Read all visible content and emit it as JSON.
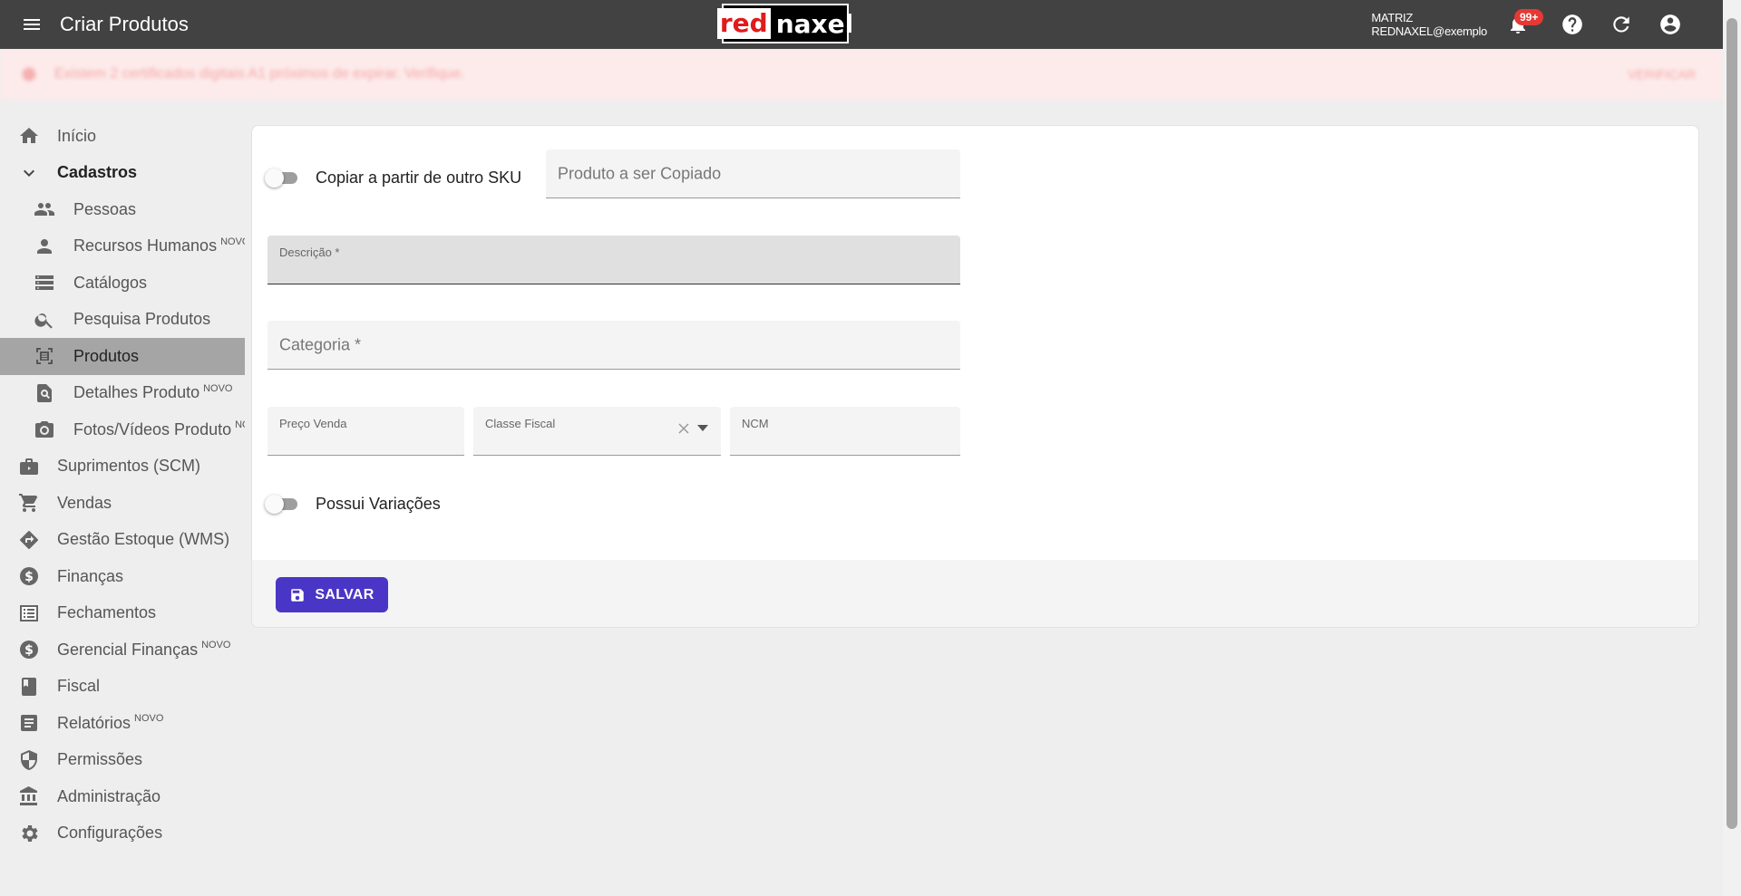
{
  "header": {
    "title": "Criar Produtos",
    "logo_left": "red",
    "logo_right": "naxel",
    "company": "MATRIZ",
    "user": "REDNAXEL@exemplo",
    "notifications_badge": "99+"
  },
  "alert": {
    "text": "Existem 2 certificados digitais A1 próximos de expirar. Verifique.",
    "action": "VERIFICAR"
  },
  "sidebar": {
    "items": [
      {
        "label": "Início",
        "icon": "home-icon"
      },
      {
        "label": "Cadastros",
        "icon": "chevron-down-icon"
      },
      {
        "label": "Pessoas",
        "icon": "people-icon"
      },
      {
        "label": "Recursos Humanos",
        "tag": "NOVO",
        "icon": "person-icon"
      },
      {
        "label": "Catálogos",
        "icon": "list-icon"
      },
      {
        "label": "Pesquisa Produtos",
        "icon": "search-icon"
      },
      {
        "label": "Produtos",
        "icon": "barcode-icon"
      },
      {
        "label": "Detalhes Produto",
        "tag": "NOVO",
        "icon": "page-search-icon"
      },
      {
        "label": "Fotos/Vídeos Produto",
        "tag": "NOVO",
        "icon": "camera-icon"
      },
      {
        "label": "Suprimentos (SCM)",
        "icon": "briefcase-icon"
      },
      {
        "label": "Vendas",
        "icon": "cart-icon"
      },
      {
        "label": "Gestão Estoque (WMS)",
        "icon": "directions-icon"
      },
      {
        "label": "Finanças",
        "icon": "dollar-icon"
      },
      {
        "label": "Fechamentos",
        "icon": "receipt-list-icon"
      },
      {
        "label": "Gerencial Finanças",
        "tag": "NOVO",
        "icon": "dollar-icon"
      },
      {
        "label": "Fiscal",
        "icon": "book-icon"
      },
      {
        "label": "Relatórios",
        "tag": "NOVO",
        "icon": "document-icon"
      },
      {
        "label": "Permissões",
        "icon": "shield-icon"
      },
      {
        "label": "Administração",
        "icon": "bank-icon"
      },
      {
        "label": "Configurações",
        "icon": "gear-icon"
      }
    ]
  },
  "form": {
    "copy_toggle_label": "Copiar a partir de outro SKU",
    "copy_product_placeholder": "Produto a ser Copiado",
    "description_label": "Descrição *",
    "category_placeholder": "Categoria *",
    "price_label": "Preço Venda",
    "fiscal_class_label": "Classe Fiscal",
    "ncm_label": "NCM",
    "variations_toggle_label": "Possui Variações",
    "save_label": "SALVAR"
  },
  "colors": {
    "topbar": "#424242",
    "primary_button": "#4a36c6",
    "badge": "#e53935",
    "active_nav": "#a5a5a5"
  }
}
